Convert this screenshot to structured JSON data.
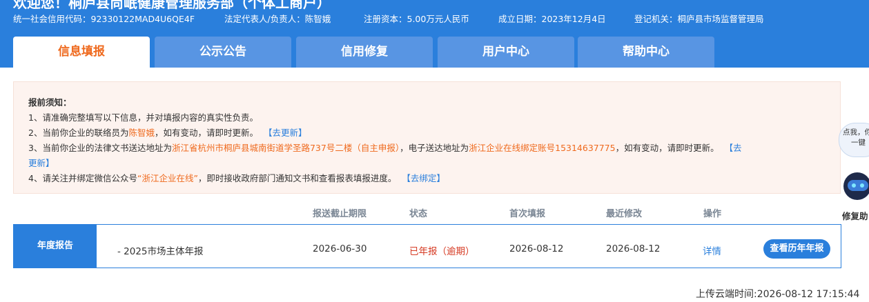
{
  "header": {
    "welcome": "欢迎您！桐庐县尚岷健康管理服务部（个体工商户）",
    "credit_code": "统一社会信用代码：92330122MAD4U6QE4F",
    "legal_rep": "法定代表人/负责人：陈智娥",
    "capital": "注册资本：5.00万元人民币",
    "established": "成立日期：2023年12月4日",
    "authority": "登记机关：桐庐县市场监督管理局"
  },
  "tabs": [
    {
      "label": "信息填报",
      "active": true
    },
    {
      "label": "公示公告"
    },
    {
      "label": "信用修复"
    },
    {
      "label": "用户中心"
    },
    {
      "label": "帮助中心"
    }
  ],
  "notice": {
    "title": "报前须知：",
    "line1": "1、请准确完整填写以下信息，并对填报内容的真实性负责。",
    "line2_pre": "2、当前你企业的联络员为",
    "line2_name": "陈智娥",
    "line2_post": "，如有变动，请即时更新。",
    "line2_link": "【去更新】",
    "line3_pre": "3、当前你企业的法律文书送达地址为",
    "line3_addr": "浙江省杭州市桐庐县城南街道学圣路737号二楼（自主申报）",
    "line3_mid": "，电子送达地址为",
    "line3_eaddr": "浙江企业在线绑定账号15314637775",
    "line3_post": "，如有变动，请即时更新。",
    "line3_link_a": "【去",
    "line3_link_b": "更新】",
    "line4_pre": "4、请关注并绑定微信公众号",
    "line4_name": "“浙江企业在线”",
    "line4_post": "，即时接收政府部门通知文书和查看报表填报进度。",
    "line4_link": "【去绑定】"
  },
  "table": {
    "headers": [
      "报送截止期限",
      "状态",
      "首次填报",
      "最近修改",
      "操作"
    ],
    "row": {
      "label": "年度报告",
      "name": "- 2025市场主体年报",
      "deadline": "2026-06-30",
      "status": "已年报（逾期）",
      "first": "2026-08-12",
      "last": "2026-08-12",
      "action": "详情",
      "button": "查看历年年报"
    }
  },
  "footer": {
    "upload_time": "上传云端时间:2026-08-12 17:15:44"
  },
  "assistant": {
    "bubble_line1": "点我，你",
    "bubble_line2": "一键",
    "label": "修复助"
  },
  "colors": {
    "brand_blue": "#2a7fdc",
    "tab_blue": "#5895e3",
    "highlight_orange": "#ef6a1e",
    "status_red": "#d63b24",
    "notice_bg": "#fdf3ef"
  }
}
